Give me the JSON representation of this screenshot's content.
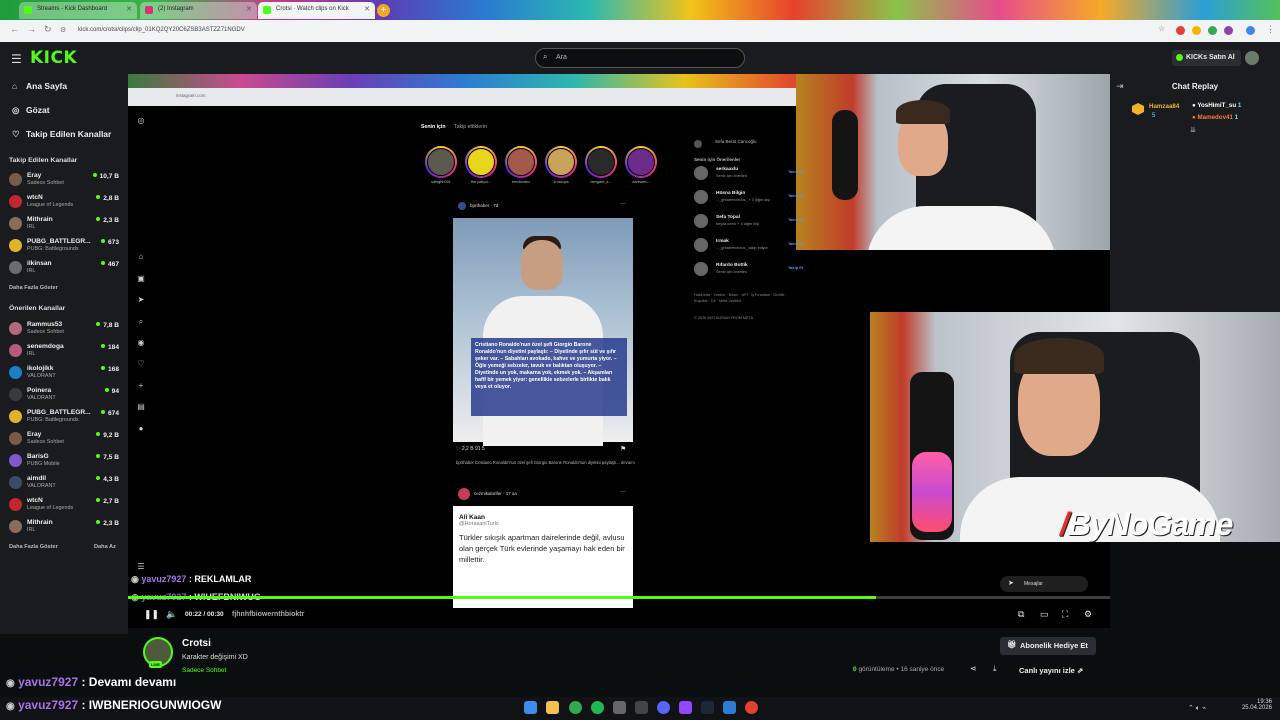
{
  "browser": {
    "tabs": [
      {
        "label": "Streams - Kick Dashboard",
        "color": "#53fc18"
      },
      {
        "label": "(2) Instagram",
        "color": "#d9317a"
      },
      {
        "label": "Crotsi · Watch clips on Kick",
        "color": "#53fc18"
      }
    ],
    "url": "kick.com/crotsi/clips/clip_01KQ2QY20C6ZSB3ASTZZ71NGDV"
  },
  "header": {
    "logo": "KICK",
    "search_placeholder": "Ara",
    "buy_kicks": "KICKs Satın Al"
  },
  "sidebar": {
    "nav": [
      {
        "label": "Ana Sayfa",
        "icon": "home-icon"
      },
      {
        "label": "Gözat",
        "icon": "compass-icon"
      },
      {
        "label": "Takip Edilen Kanallar",
        "icon": "heart-icon"
      }
    ],
    "followed_title": "Takip Edilen Kanallar",
    "followed": [
      {
        "name": "Eray",
        "category": "Sadece Sohbet",
        "viewers": "10,7 B",
        "avatar": "#7a5a48"
      },
      {
        "name": "wtcN",
        "category": "League of Legends",
        "viewers": "2,8 B",
        "avatar": "#c2262e"
      },
      {
        "name": "Mithrain",
        "category": "IRL",
        "viewers": "2,3 B",
        "avatar": "#8a6c5a"
      },
      {
        "name": "PUBG_BATTLEGR...",
        "category": "PUBG: Battlegrounds",
        "viewers": "673",
        "avatar": "#e0b42a"
      },
      {
        "name": "ilkinsan",
        "category": "IRL",
        "viewers": "467",
        "avatar": "#6c6c70"
      }
    ],
    "followed_more": "Daha Fazla Göster",
    "recommended_title": "Önerilen Kanallar",
    "recommended": [
      {
        "name": "Rammus53",
        "category": "Sadece Sohbet",
        "viewers": "7,8 B",
        "avatar": "#b06a7c"
      },
      {
        "name": "senemdoga",
        "category": "IRL",
        "viewers": "184",
        "avatar": "#b55a78"
      },
      {
        "name": "ikolojikk",
        "category": "VALORANT",
        "viewers": "168",
        "avatar": "#1b7fc7"
      },
      {
        "name": "Poinera",
        "category": "VALORANT",
        "viewers": "94",
        "avatar": "#3a3a3a"
      },
      {
        "name": "PUBG_BATTLEGR...",
        "category": "PUBG: Battlegrounds",
        "viewers": "674",
        "avatar": "#e0b42a"
      },
      {
        "name": "Eray",
        "category": "Sadece Sohbet",
        "viewers": "9,2 B",
        "avatar": "#7a5a48"
      },
      {
        "name": "BarisG",
        "category": "PUBG Mobile",
        "viewers": "7,5 B",
        "avatar": "#7d5ac7"
      },
      {
        "name": "aimdll",
        "category": "VALORANT",
        "viewers": "4,3 B",
        "avatar": "#3a4c6b"
      },
      {
        "name": "wtcN",
        "category": "League of Legends",
        "viewers": "2,7 B",
        "avatar": "#c2262e"
      },
      {
        "name": "Mithrain",
        "category": "IRL",
        "viewers": "2,3 B",
        "avatar": "#8a6c5a"
      }
    ],
    "recommended_more": "Daha Fazla Göster",
    "recommended_less": "Daha Az"
  },
  "instagram": {
    "inner_url": "instagram.com",
    "feed_tabs": [
      "Senin için",
      "Takip ettiklerin"
    ],
    "stories": [
      "sdfsgfm001",
      "the.pallycl...",
      "emrkbrdnz",
      "1rockups",
      "bengard_k...",
      "darkweb..."
    ],
    "post1_user": "bprthaber",
    "post1_time": "7d",
    "post1_card": "Cristiano Ronaldo'nun özel şefi Giorgio Barone Ronaldo'nun diyetini paylaştı: – Diyetinde şıfır süt ve şıfır şeker var. – Sabahları avokado, kahve ve yumurta yiyor. – Öğle yemeği sebzeler, tavuk ve balıktan oluşuyor. – Diyetinde un yok, makarna yok, ekmek yok. – Akşamları hafif bir yemek yiyor: genellikle sebzelerle birlikte balık veya et oluyor.",
    "post1_stats": "2,2 B   91   5",
    "post1_caption": "bprthaber Cristiano Ronaldo'nun özel şefi Giorgio Barone Ronaldo'nun diyetini paylaştı... devamı",
    "post2_user": "cezmikalorifer",
    "post2_time": "17 sa",
    "post2_author": "Ali Kaan",
    "post2_handle": "@HorasaniTurki",
    "post2_text": "Türkler sıkışık apartman dairelerinde değil, avlusu olan gerçek Türk evlerinde yaşamayı hak eden bir millettir.",
    "side_top_user": "Sefa Berat Cancoğlu",
    "suggest_title": "Senin için Önerilenler",
    "suggestions": [
      {
        "name": "serkaaxlu",
        "sub": "Senin için önerilen"
      },
      {
        "name": "Hüsna Bilgin",
        "sub": "..._greatemchous_ + 3 diğer kişi"
      },
      {
        "name": "Sefa Topal",
        "sub": "beyza.ozmir + 4 diğer kişi"
      },
      {
        "name": "Irmak",
        "sub": "..._greatemchous_ takip ediyor"
      },
      {
        "name": "Rıfardo Bottik",
        "sub": "Senin için önerilen"
      }
    ],
    "follow_label": "Takip Et",
    "footer": "Hakkında · Yardım · Basın · API · İş Fırsatları · Gizlilik · Koşullar · Dil · Meta Verified",
    "copyright": "© 2026 INSTAGRAM FROM META",
    "messages_label": "Mesajlar"
  },
  "chat": {
    "title": "Chat Replay",
    "gifter": "Hamzaa84",
    "gifter_count": "5",
    "gifted1": "YosHimiT_su",
    "gifted1_count": "1",
    "gifted2": "Mamedov41",
    "gifted2_count": "1"
  },
  "overlay_chat": [
    {
      "user": "yavuz7927",
      "message": "REKLAMLAR"
    },
    {
      "user": "yavuz7927",
      "message": "WIUEFBNIWUG"
    },
    {
      "user": "",
      "message": "fjhnhfbiowernthbioktr"
    },
    {
      "user": "yavuz7927",
      "message": "Devamı devamı"
    },
    {
      "user": "yavuz7927",
      "message": "IWBNERIOGUNWIOGW"
    }
  ],
  "player": {
    "time": "00:22 / 00:30",
    "progress": 0.762
  },
  "channel": {
    "name": "Crotsi",
    "title": "Karakter değişimi XD",
    "category": "Sadece Sohbet",
    "live": "LIVE",
    "views": "0",
    "views_label": "görüntüleme",
    "ago": "16 saniye önce",
    "gift_sub": "Abonelik Hediye Et",
    "watch_live": "Canlı yayını izle"
  },
  "webcam_brand": "ByNoGame",
  "taskbar": {
    "time": "19:36",
    "date": "25.04.2026"
  }
}
